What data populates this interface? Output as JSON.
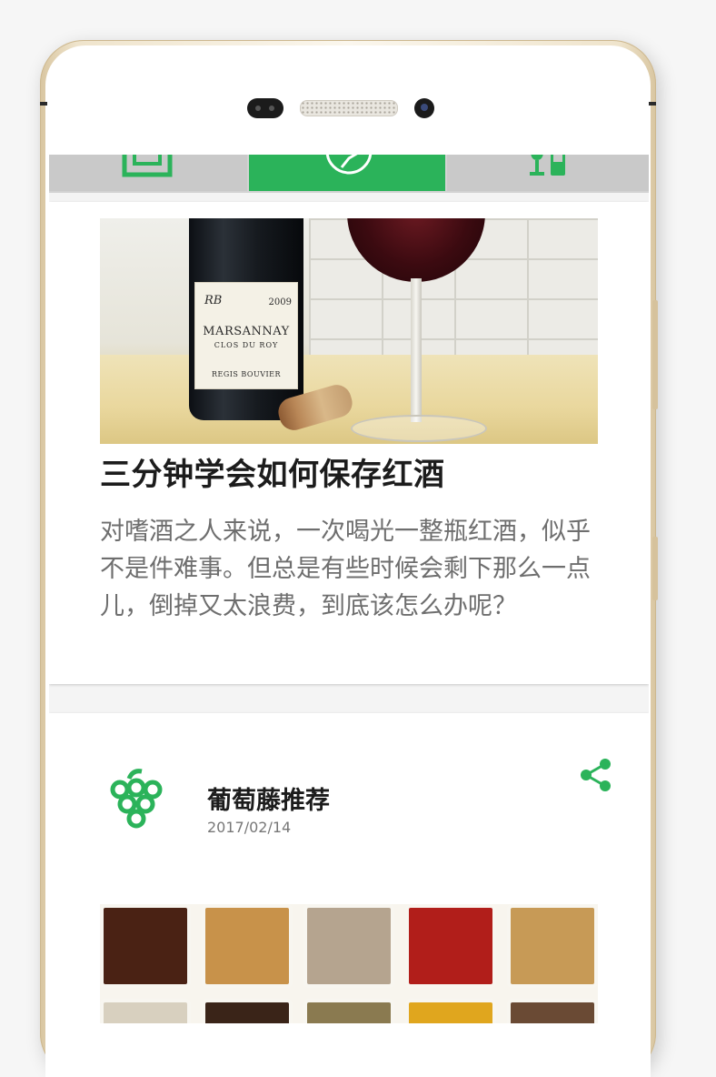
{
  "tabs": [
    {
      "name": "tab-home",
      "icon": "frame-icon",
      "active": false
    },
    {
      "name": "tab-discover",
      "icon": "compass-icon",
      "active": true
    },
    {
      "name": "tab-wine",
      "icon": "wine-bottle-glass-icon",
      "active": false
    }
  ],
  "colors": {
    "accent": "#2bb35a",
    "title": "#1c1c1c",
    "body": "#6e6e6e",
    "meta": "#777777"
  },
  "article": {
    "photo_label": {
      "monogram": "RB",
      "year": "2009",
      "brand": "MARSANNAY",
      "sub": "CLOS DU ROY",
      "maker": "REGIS BOUVIER"
    },
    "title": "三分钟学会如何保存红酒",
    "description": "对嗜酒之人来说，一次喝光一整瓶红酒，似乎不是件难事。但总是有些时候会剩下那么一点儿，倒掉又太浪费，到底该怎么办呢？"
  },
  "post": {
    "author": "葡萄藤推荐",
    "date": "2017/02/14",
    "icons": {
      "avatar": "grape-icon",
      "share": "share-icon"
    }
  }
}
